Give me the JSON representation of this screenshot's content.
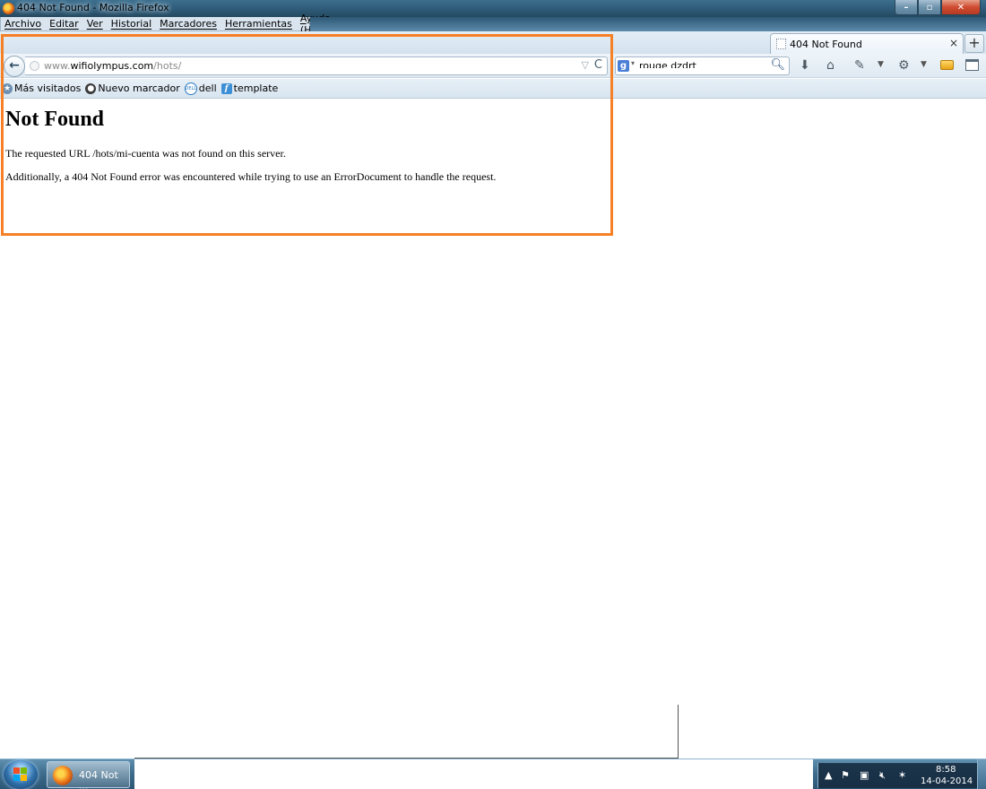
{
  "window": {
    "title": "404 Not Found - Mozilla Firefox",
    "controls": {
      "minimize": "–",
      "maximize": "▫",
      "close": "✕"
    }
  },
  "menubar": {
    "items": [
      "Archivo",
      "Editar",
      "Ver",
      "Historial",
      "Marcadores",
      "Herramientas",
      "Ayuda (H)"
    ]
  },
  "tabs": {
    "active": {
      "title": "404 Not Found",
      "close": "×"
    },
    "new_tab": "+"
  },
  "navbar": {
    "back": "←",
    "url": {
      "prefix": "www.",
      "host": "wifiolympus.com",
      "path": "/hots/"
    },
    "reload": "C",
    "bookmark_star": "▽",
    "search": {
      "engine": "g",
      "engine_drop": "▾",
      "query": "rouge dzdrt",
      "icon": "search-icon"
    },
    "toolbar_icons": [
      "download-icon",
      "home-icon",
      "addon-icon",
      "menu-chevron-icon",
      "tools-icon",
      "menu-chevron-icon",
      "ui-icon",
      "window-icon"
    ]
  },
  "bookmarks": {
    "items": [
      {
        "label": "Más visitados",
        "icon": "most-visited-icon"
      },
      {
        "label": "Nuevo marcador",
        "icon": "bookmark-icon"
      },
      {
        "label": "dell",
        "icon": "dell-icon"
      },
      {
        "label": "template",
        "icon": "template-icon"
      }
    ]
  },
  "page": {
    "heading": "Not Found",
    "message": "The requested URL /hots/mi-cuenta was not found on this server.",
    "additional": "Additionally, a 404 Not Found error was encountered while trying to use an ErrorDocument to handle the request."
  },
  "highlight": {
    "color": "#f58026"
  },
  "taskbar": {
    "task_label": "404 Not ...",
    "tray_icons": [
      "chevron-up-icon",
      "flag-icon",
      "network-icon",
      "volume-muted-icon",
      "bluetooth-icon"
    ],
    "clock": {
      "time": "8:58",
      "date": "14-04-2014"
    }
  }
}
